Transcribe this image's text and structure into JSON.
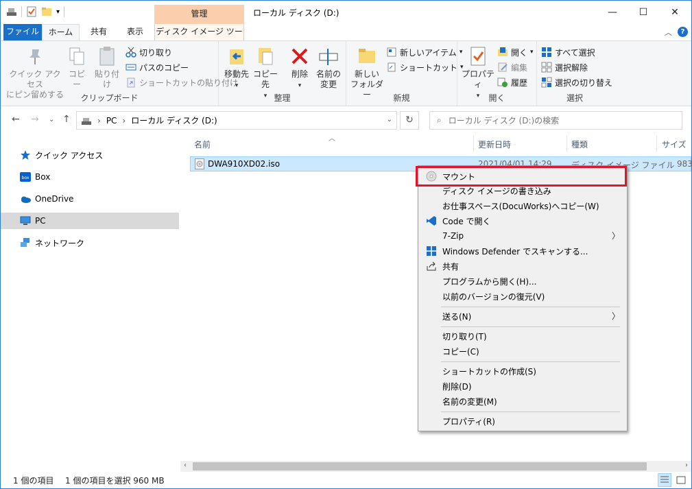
{
  "window": {
    "title": "ローカル ディスク (D:)",
    "context_tab_header": "管理",
    "controls": {
      "minimize": "—",
      "maximize": "☐",
      "close": "✕"
    }
  },
  "ribbon_tabs": {
    "file": "ファイル",
    "home": "ホーム",
    "share": "共有",
    "view": "表示",
    "disk_image_tools": "ディスク イメージ ツール"
  },
  "ribbon": {
    "clipboard": {
      "label": "クリップボード",
      "pin_line1": "クイック アクセス",
      "pin_line2": "にピン留めする",
      "copy": "コピー",
      "paste": "貼り付け",
      "cut": "切り取り",
      "copy_path": "パスのコピー",
      "paste_shortcut": "ショートカットの貼り付け"
    },
    "organize": {
      "label": "整理",
      "move_to": "移動先",
      "copy_to": "コピー先",
      "delete": "削除",
      "rename_line1": "名前の",
      "rename_line2": "変更"
    },
    "new": {
      "label": "新規",
      "new_folder_line1": "新しい",
      "new_folder_line2": "フォルダー",
      "new_item": "新しいアイテム",
      "easy_access": "ショートカット"
    },
    "open": {
      "label": "開く",
      "properties": "プロパティ",
      "open": "開く",
      "edit": "編集",
      "history": "履歴"
    },
    "select": {
      "label": "選択",
      "select_all": "すべて選択",
      "select_none": "選択解除",
      "invert": "選択の切り替え"
    }
  },
  "address": {
    "crumb_pc": "PC",
    "crumb_drive": "ローカル ディスク (D:)",
    "search_placeholder": "ローカル ディスク (D:)の検索"
  },
  "nav_pane": {
    "items": [
      {
        "label": "クイック アクセス",
        "icon": "star-icon"
      },
      {
        "label": "Box",
        "icon": "box-icon"
      },
      {
        "label": "OneDrive",
        "icon": "cloud-icon"
      },
      {
        "label": "PC",
        "icon": "computer-icon"
      },
      {
        "label": "ネットワーク",
        "icon": "network-icon"
      }
    ],
    "selected": "PC"
  },
  "file_list": {
    "columns": [
      "名前",
      "更新日時",
      "種類",
      "サイズ"
    ],
    "rows": [
      {
        "name": "DWA910XD02.iso",
        "modified": "2021/04/01 14:29",
        "type": "ディスク イメージ ファイル",
        "size": "983,"
      }
    ]
  },
  "context_menu": {
    "items": [
      {
        "label": "マウント",
        "icon": "disc-icon",
        "highlighted": true
      },
      {
        "label": "ディスク イメージの書き込み"
      },
      {
        "label": "お仕事スペース(DocuWorks)へコピー(W)"
      },
      {
        "label": "Code で開く",
        "icon": "vscode-icon"
      },
      {
        "label": "7-Zip",
        "submenu": true
      },
      {
        "label": "Windows Defender でスキャンする...",
        "icon": "defender-icon"
      },
      {
        "label": "共有",
        "icon": "share-icon"
      },
      {
        "label": "プログラムから開く(H)..."
      },
      {
        "label": "以前のバージョンの復元(V)"
      },
      {
        "label": "送る(N)",
        "submenu": true
      },
      {
        "label": "切り取り(T)"
      },
      {
        "label": "コピー(C)"
      },
      {
        "label": "ショートカットの作成(S)"
      },
      {
        "label": "削除(D)"
      },
      {
        "label": "名前の変更(M)"
      },
      {
        "label": "プロパティ(R)"
      }
    ],
    "submenu_arrow": "〉"
  },
  "status_bar": {
    "item_count": "1 個の項目",
    "selected": "1 個の項目を選択  960 MB"
  },
  "colors": {
    "accent": "#1a6fc9",
    "manage_tab": "#fbcfae",
    "selection": "#cce8ff",
    "highlight_box": "#e0142b"
  }
}
